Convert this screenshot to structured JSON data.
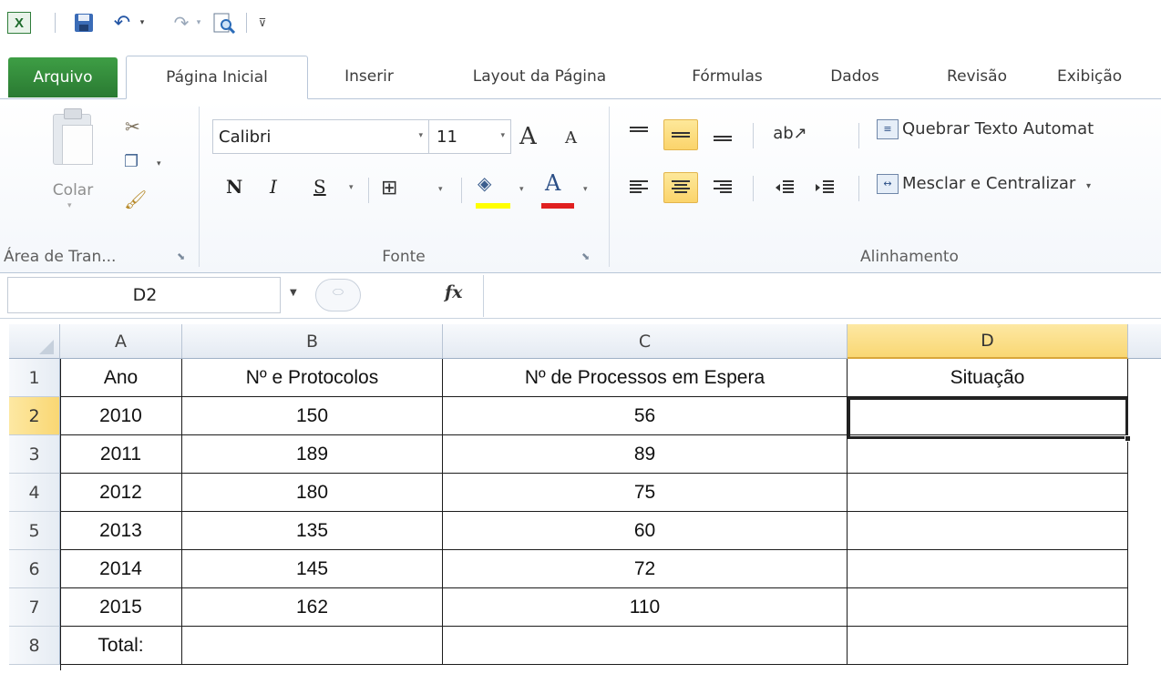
{
  "qat": {
    "app_icon": "excel-icon",
    "save_icon": "disk-icon",
    "undo_glyph": "↶",
    "redo_glyph": "↷",
    "dropdown_glyph": "▾",
    "customize_glyph": "⊽"
  },
  "tabs": [
    {
      "label": "Arquivo"
    },
    {
      "label": "Página Inicial"
    },
    {
      "label": "Inserir"
    },
    {
      "label": "Layout da Página"
    },
    {
      "label": "Fórmulas"
    },
    {
      "label": "Dados"
    },
    {
      "label": "Revisão"
    },
    {
      "label": "Exibição"
    }
  ],
  "ribbon": {
    "clipboard": {
      "paste_label": "Colar",
      "group_label": "Área de Tran..."
    },
    "font": {
      "font_name": "Calibri",
      "font_size": "11",
      "grow_glyph": "A",
      "shrink_glyph": "A",
      "bold_glyph": "N",
      "italic_glyph": "I",
      "underline_glyph": "S",
      "fill_glyph": "◈",
      "font_color_glyph": "A",
      "group_label": "Fonte",
      "fill_color": "#ffff00",
      "font_color": "#e02020"
    },
    "alignment": {
      "wrap_text_label": "Quebrar Texto Automat",
      "merge_center_label": "Mesclar e Centralizar",
      "group_label": "Alinhamento"
    }
  },
  "formula_bar": {
    "name_box": "D2",
    "fx_label": "fx",
    "formula": ""
  },
  "sheet": {
    "columns": [
      "A",
      "B",
      "C",
      "D"
    ],
    "active_column": "D",
    "active_row": "2",
    "rows": [
      {
        "num": "1",
        "cells": [
          "Ano",
          "Nº e Protocolos",
          "Nº de Processos em Espera",
          "Situação"
        ]
      },
      {
        "num": "2",
        "cells": [
          "2010",
          "150",
          "56",
          ""
        ]
      },
      {
        "num": "3",
        "cells": [
          "2011",
          "189",
          "89",
          ""
        ]
      },
      {
        "num": "4",
        "cells": [
          "2012",
          "180",
          "75",
          ""
        ]
      },
      {
        "num": "5",
        "cells": [
          "2013",
          "135",
          "60",
          ""
        ]
      },
      {
        "num": "6",
        "cells": [
          "2014",
          "145",
          "72",
          ""
        ]
      },
      {
        "num": "7",
        "cells": [
          "2015",
          "162",
          "110",
          ""
        ]
      },
      {
        "num": "8",
        "cells": [
          "Total:",
          "",
          "",
          ""
        ]
      }
    ]
  }
}
